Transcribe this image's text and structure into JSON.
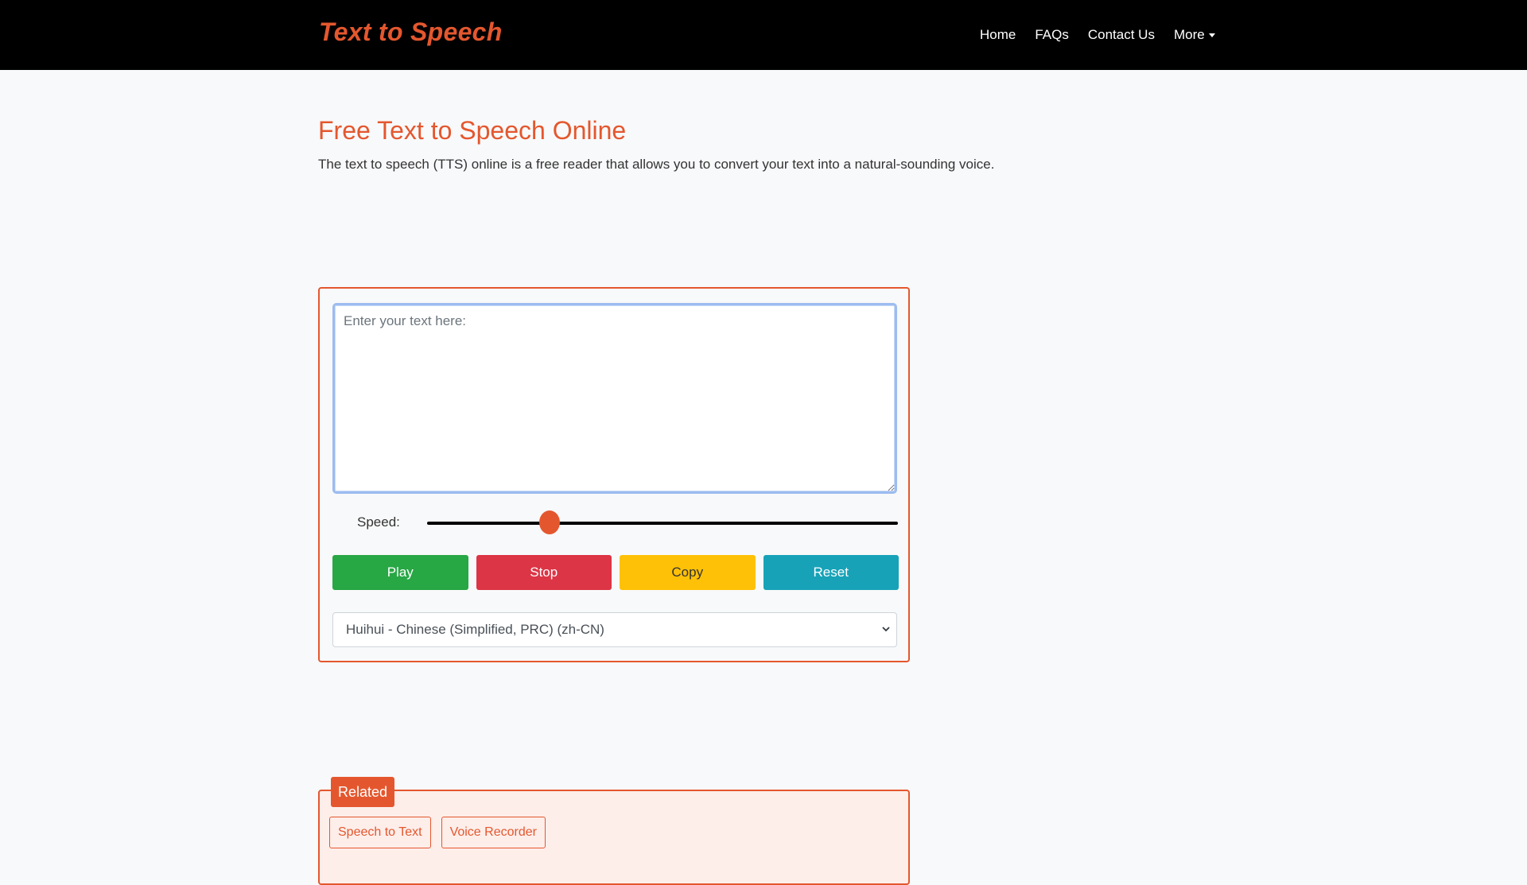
{
  "brand": "Text to Speech",
  "nav": {
    "items": [
      "Home",
      "FAQs",
      "Contact Us"
    ],
    "more_label": "More"
  },
  "page": {
    "title": "Free Text to Speech Online",
    "description": "The text to speech (TTS) online is a free reader that allows you to convert your text into a natural-sounding voice."
  },
  "tts": {
    "text_value": "",
    "text_placeholder": "Enter your text here:",
    "speed_label": "Speed:",
    "speed_level": 0.26,
    "buttons": {
      "play": "Play",
      "stop": "Stop",
      "copy": "Copy",
      "reset": "Reset"
    },
    "voice_selected": "Huihui - Chinese (Simplified, PRC) (zh-CN)"
  },
  "related": {
    "label": "Related",
    "links": [
      "Speech to Text",
      "Voice Recorder"
    ]
  },
  "colors": {
    "accent": "#e4572e",
    "play": "#28a745",
    "stop": "#dc3545",
    "copy": "#ffc107",
    "reset": "#17a2b8"
  }
}
